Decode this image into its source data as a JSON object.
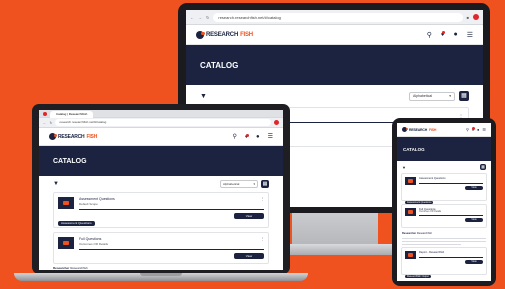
{
  "browser": {
    "url": "research.researchfish.net/#/catalog",
    "tab_title": "Catalog | ResearchFish"
  },
  "logo": {
    "primary": "RESEARCH",
    "accent": "FISH"
  },
  "icons": {
    "search": "search-icon",
    "bell": "bell-icon",
    "user": "user-icon",
    "menu": "hamburger-menu-icon",
    "grid": "grid-view-icon",
    "filter": "filter-icon",
    "more": "more-options-icon"
  },
  "page": {
    "title": "CATALOG"
  },
  "toolbar": {
    "sort_value": "Alphabetical"
  },
  "items": [
    {
      "title": "Assessment Questions",
      "sub": "Default Scope",
      "tag": "Assessment Questions",
      "action": "View"
    },
    {
      "title": "Full Questions",
      "sub": "Outcomes   OR Details",
      "action": "View",
      "tag": "Full Questions"
    },
    {
      "title": "Report - Researchfish",
      "sub": "",
      "tag": "Researchfish Output",
      "action": "View"
    }
  ],
  "notes": {
    "label": "Researcher",
    "value": "Researchfish"
  },
  "colors": {
    "brand_navy": "#1b2340",
    "brand_orange": "#f0521f",
    "background": "#f0521f"
  }
}
